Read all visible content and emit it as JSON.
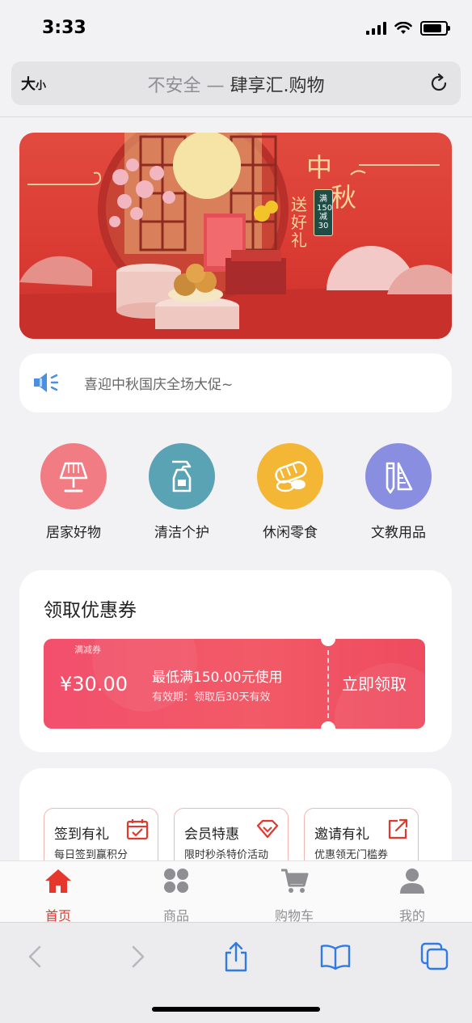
{
  "status": {
    "time": "3:33"
  },
  "address_bar": {
    "size_button_big": "大",
    "size_button_small": "小",
    "insecure_label": "不安全 —",
    "site_title": "肆享汇.购物"
  },
  "banner": {
    "title_line1": "中",
    "title_line2": "秋",
    "subtitle": "送好礼",
    "promo_tag": "满150减30"
  },
  "notice": {
    "text": "喜迎中秋国庆全场大促~"
  },
  "categories": [
    {
      "label": "居家好物",
      "icon": "lamp-icon",
      "color": "#f27c84"
    },
    {
      "label": "清洁个护",
      "icon": "spray-bottle-icon",
      "color": "#5aa3b5"
    },
    {
      "label": "休闲零食",
      "icon": "snack-icon",
      "color": "#f4b635"
    },
    {
      "label": "文教用品",
      "icon": "stationery-icon",
      "color": "#8a8ee0"
    }
  ],
  "coupon_section": {
    "title": "领取优惠券",
    "coupon": {
      "tag": "满减券",
      "amount": "¥30.00",
      "condition": "最低满150.00元使用",
      "validity": "有效期：领取后30天有效",
      "claim_label": "立即领取"
    }
  },
  "activities": [
    {
      "title": "签到有礼",
      "subtitle": "每日签到赢积分",
      "icon": "calendar-check-icon"
    },
    {
      "title": "会员特惠",
      "subtitle": "限时秒杀特价活动",
      "icon": "diamond-icon"
    },
    {
      "title": "邀请有礼",
      "subtitle": "优惠领无门槛券",
      "icon": "share-icon"
    }
  ],
  "tabbar": {
    "tabs": [
      {
        "label": "首页",
        "icon": "home-icon",
        "active": true
      },
      {
        "label": "商品",
        "icon": "grid-icon",
        "active": false
      },
      {
        "label": "购物车",
        "icon": "cart-icon",
        "active": false
      },
      {
        "label": "我的",
        "icon": "user-icon",
        "active": false
      }
    ]
  },
  "colors": {
    "accent": "#e5372b",
    "coupon": "#f24f6c",
    "banner": "#d93b33"
  }
}
